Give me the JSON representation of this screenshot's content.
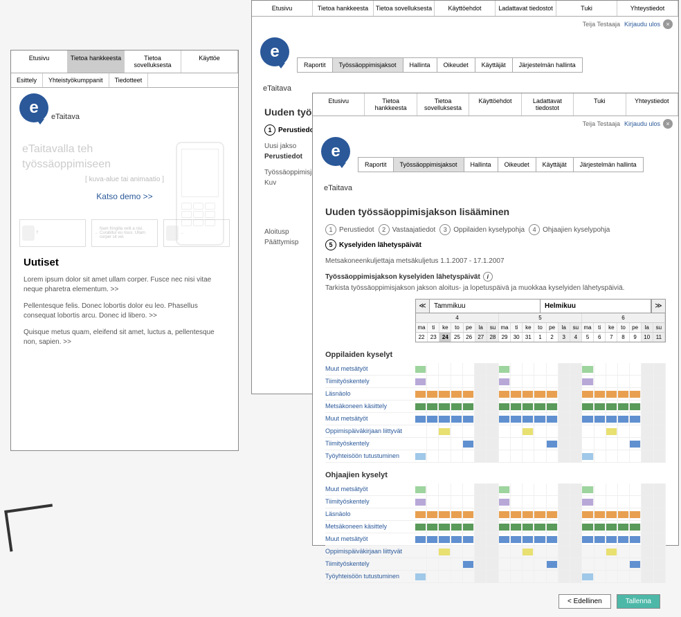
{
  "topnav": [
    "Etusivu",
    "Tietoa hankkeesta",
    "Tietoa sovelluksesta",
    "Käyttöehdot",
    "Ladattavat tiedostot",
    "Tuki",
    "Yhteystiedot"
  ],
  "subnav_w1": [
    "Esittely",
    "Yhteistyökumppanit",
    "Tiedotteet"
  ],
  "brand": {
    "logo_letter": "e",
    "name": "eTaitava"
  },
  "user": {
    "name": "Teija Testaaja",
    "logout": "Kirjaudu ulos"
  },
  "tabs": [
    "Raportit",
    "Työssäoppimisjaksot",
    "Hallinta",
    "Oikeudet",
    "Käyttäjät",
    "Järjestelmän hallinta"
  ],
  "w2": {
    "title": "Uuden työssäo",
    "step1": "Perustiedot",
    "sub1": "Uusi jakso",
    "sub2": "Perustiedot",
    "line1": "Työssäoppimisjakson",
    "line2": "Kuv",
    "line3": "Aloitusp",
    "line4": "Päättymisp"
  },
  "w3": {
    "title": "Uuden työssäoppimisjakson lisääminen",
    "steps": [
      "Perustiedot",
      "Vastaajatiedot",
      "Oppilaiden kyselypohja",
      "Ohjaajien kyselypohja",
      "Kyselyiden lähetyspäivät"
    ],
    "meta": "Metsakoneenkuljettaja metsäkuljetus  1.1.2007 - 17.1.2007",
    "section_label": "Työssäoppimisjakson kyselyiden lähetyspäivät",
    "instruction": "Tarkista työssäoppimisjakson jakson aloitus- ja lopetuspäivä ja muokkaa kyselyiden lähetyspäiviä.",
    "months": [
      "Tammikuu",
      "Helmikuu"
    ],
    "weeks": [
      "4",
      "5",
      "6"
    ],
    "dows": [
      "ma",
      "ti",
      "ke",
      "to",
      "pe",
      "la",
      "su",
      "ma",
      "ti",
      "ke",
      "to",
      "pe",
      "la",
      "su",
      "ma",
      "ti",
      "ke",
      "to",
      "pe",
      "la",
      "su"
    ],
    "days": [
      "22",
      "23",
      "24",
      "25",
      "26",
      "27",
      "28",
      "29",
      "30",
      "31",
      "1",
      "2",
      "3",
      "4",
      "5",
      "6",
      "7",
      "8",
      "9",
      "10",
      "11"
    ],
    "oppilaiden_title": "Oppilaiden kyselyt",
    "ohjaajien_title": "Ohjaajien kyselyt",
    "rows": [
      "Muut metsätyöt",
      "Tiimityöskentely",
      "Läsnäolo",
      "Metsäkoneen käsittely",
      "Muut metsätyöt",
      "Oppimispäiväkirjaan liittyvät",
      "Tiimityöskentely",
      "Työyhteisöön tutustuminen"
    ],
    "btn_prev": "< Edellinen",
    "btn_save": "Tallenna"
  },
  "w1": {
    "hero1": "eTaitavalla teh",
    "hero2": "työssäoppimiseen",
    "hero_sub": "[ kuva-alue tai animaatio ]",
    "hero_link": "Katso demo >>",
    "icon_text": "Nam fringilla velit a nisi. Curabitur eu risus. Ullam corper sit vel.",
    "news_title": "Uutiset",
    "p1": "Lorem ipsum dolor sit amet ullam corper. Fusce nec nisi vitae neque pharetra elementum. >>",
    "p2": "Pellentesque felis. Donec lobortis dolor eu leo. Phasellus consequat lobortis arcu. Donec id libero. >>",
    "p3": "Quisque metus quam, eleifend sit amet, luctus a, pellentesque non, sapien. >>"
  },
  "chart_data": {
    "type": "heatmap",
    "title": "Kyselyiden lähetyspäivät",
    "date_range": "22.1.2007 – 11.2.2007",
    "columns": [
      "22",
      "23",
      "24",
      "25",
      "26",
      "27",
      "28",
      "29",
      "30",
      "31",
      "1",
      "2",
      "3",
      "4",
      "5",
      "6",
      "7",
      "8",
      "9",
      "10",
      "11"
    ],
    "groups": [
      {
        "name": "Oppilaiden kyselyt",
        "rows": [
          {
            "name": "Muut metsätyöt",
            "pattern": "gr"
          },
          {
            "name": "Tiimityöskentely",
            "pattern": "pu"
          },
          {
            "name": "Läsnäolo",
            "pattern": "or_daily"
          },
          {
            "name": "Metsäkoneen käsittely",
            "pattern": "dg_daily"
          },
          {
            "name": "Muut metsätyöt",
            "pattern": "bl_daily"
          },
          {
            "name": "Oppimispäiväkirjaan liittyvät",
            "pattern": "ye"
          },
          {
            "name": "Tiimityöskentely",
            "pattern": "bl"
          },
          {
            "name": "Työyhteisöön tutustuminen",
            "pattern": "lb"
          }
        ]
      },
      {
        "name": "Ohjaajien kyselyt",
        "rows": [
          {
            "name": "Muut metsätyöt",
            "pattern": "gr"
          },
          {
            "name": "Tiimityöskentely",
            "pattern": "pu"
          },
          {
            "name": "Läsnäolo",
            "pattern": "or_daily"
          },
          {
            "name": "Metsäkoneen käsittely",
            "pattern": "dg_daily"
          },
          {
            "name": "Muut metsätyöt",
            "pattern": "bl_daily"
          },
          {
            "name": "Oppimispäiväkirjaan liittyvät",
            "pattern": "ye"
          },
          {
            "name": "Tiimityöskentely",
            "pattern": "bl"
          },
          {
            "name": "Työyhteisöön tutustuminen",
            "pattern": "lb"
          }
        ]
      }
    ],
    "legend": {
      "gr": "light-green",
      "pu": "purple",
      "or": "orange",
      "dg": "dark-green",
      "bl": "blue",
      "ye": "yellow",
      "lb": "light-blue"
    }
  }
}
